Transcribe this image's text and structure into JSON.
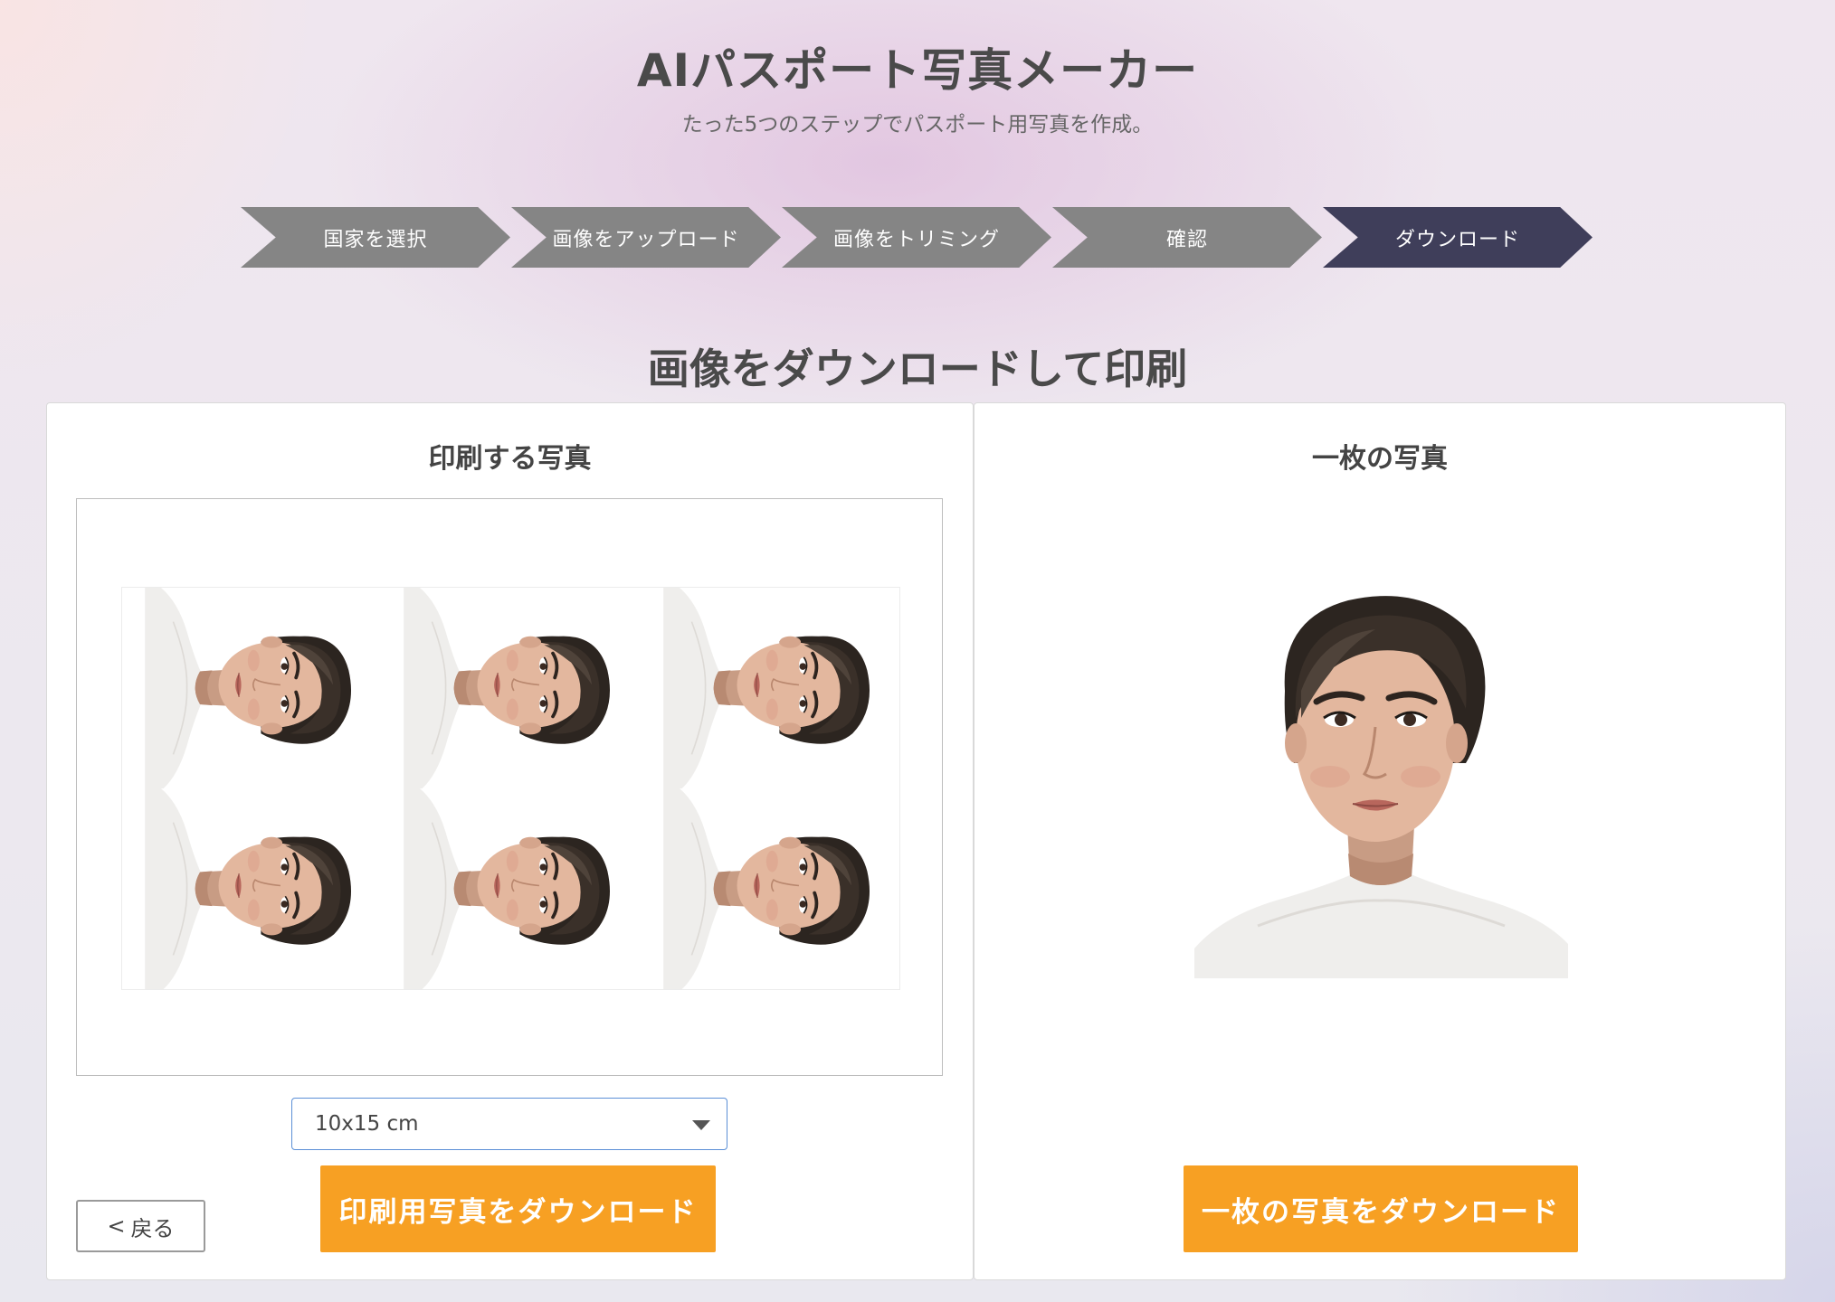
{
  "header": {
    "title": "AIパスポート写真メーカー",
    "subtitle": "たった5つのステップでパスポート用写真を作成。"
  },
  "steps": [
    {
      "label": "国家を選択",
      "active": false
    },
    {
      "label": "画像をアップロード",
      "active": false
    },
    {
      "label": "画像をトリミング",
      "active": false
    },
    {
      "label": "確認",
      "active": false
    },
    {
      "label": "ダウンロード",
      "active": true
    }
  ],
  "section_title": "画像をダウンロードして印刷",
  "print_panel": {
    "title": "印刷する写真",
    "size_select": {
      "value": "10x15 cm"
    },
    "back_button": {
      "icon": "chevron-left-icon",
      "label": "戻る"
    },
    "download_button": "印刷用写真をダウンロード"
  },
  "single_panel": {
    "title": "一枚の写真",
    "download_button": "一枚の写真をダウンロード"
  },
  "colors": {
    "active_step": "#3f3e5a",
    "inactive_step": "#858585",
    "button_orange": "#f7a023",
    "select_border": "#5b8fd6"
  }
}
